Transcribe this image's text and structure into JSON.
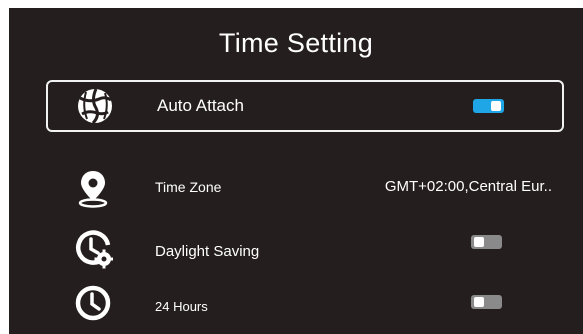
{
  "title": "Time Setting",
  "colors": {
    "background": "#241e1e",
    "text": "#ffffff",
    "toggle_on": "#1ea6e6",
    "toggle_off": "#8a8a8a"
  },
  "items": [
    {
      "label": "Auto Attach",
      "icon": "satellite-globe-icon",
      "control": "toggle",
      "state": "on",
      "selected": true
    },
    {
      "label": "Time Zone",
      "icon": "location-pin-icon",
      "control": "value",
      "value": "GMT+02:00,Central Eur.."
    },
    {
      "label": "Daylight Saving",
      "icon": "clock-settings-icon",
      "control": "toggle",
      "state": "off"
    },
    {
      "label": "24 Hours",
      "icon": "clock-icon",
      "control": "toggle",
      "state": "off"
    }
  ]
}
